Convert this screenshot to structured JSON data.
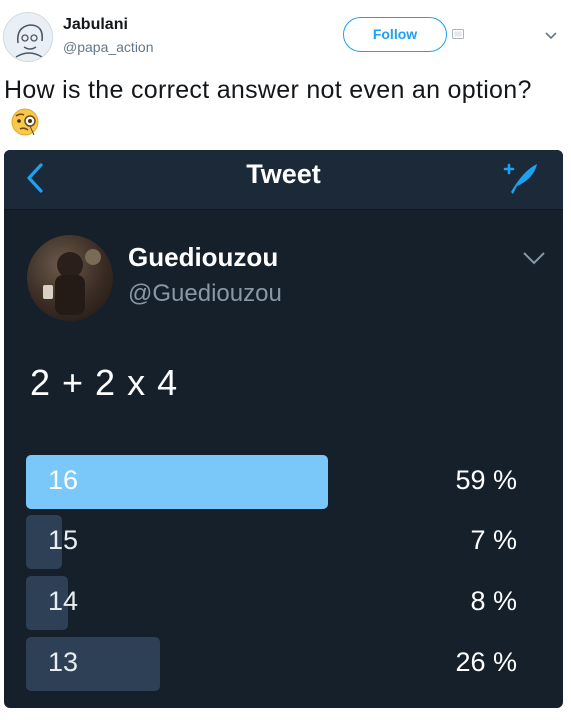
{
  "tweet": {
    "user_name": "Jabulani",
    "user_handle": "@papa_action",
    "follow_label": "Follow",
    "text": "How is the correct answer not even an option?"
  },
  "embedded": {
    "app_bar_title": "Tweet",
    "author_name": "Guediouzou",
    "author_handle": "@Guediouzou",
    "question": "2 + 2 x 4",
    "poll": [
      {
        "label": "16",
        "percent": "59 %",
        "share": 0.59,
        "winner": true
      },
      {
        "label": "15",
        "percent": "7 %",
        "share": 0.07,
        "winner": false
      },
      {
        "label": "14",
        "percent": "8 %",
        "share": 0.08,
        "winner": false
      },
      {
        "label": "13",
        "percent": "26 %",
        "share": 0.26,
        "winner": false
      }
    ]
  },
  "colors": {
    "accent": "#1da1f2",
    "poll_winner": "#7ac7f9",
    "poll_bar": "#2e4056",
    "dark_bg": "#15202b"
  },
  "icons": {
    "back": "chevron-left-icon",
    "compose": "compose-tweet-icon",
    "more": "chevron-down-icon",
    "emoji": "face-with-monocle-emoji"
  }
}
